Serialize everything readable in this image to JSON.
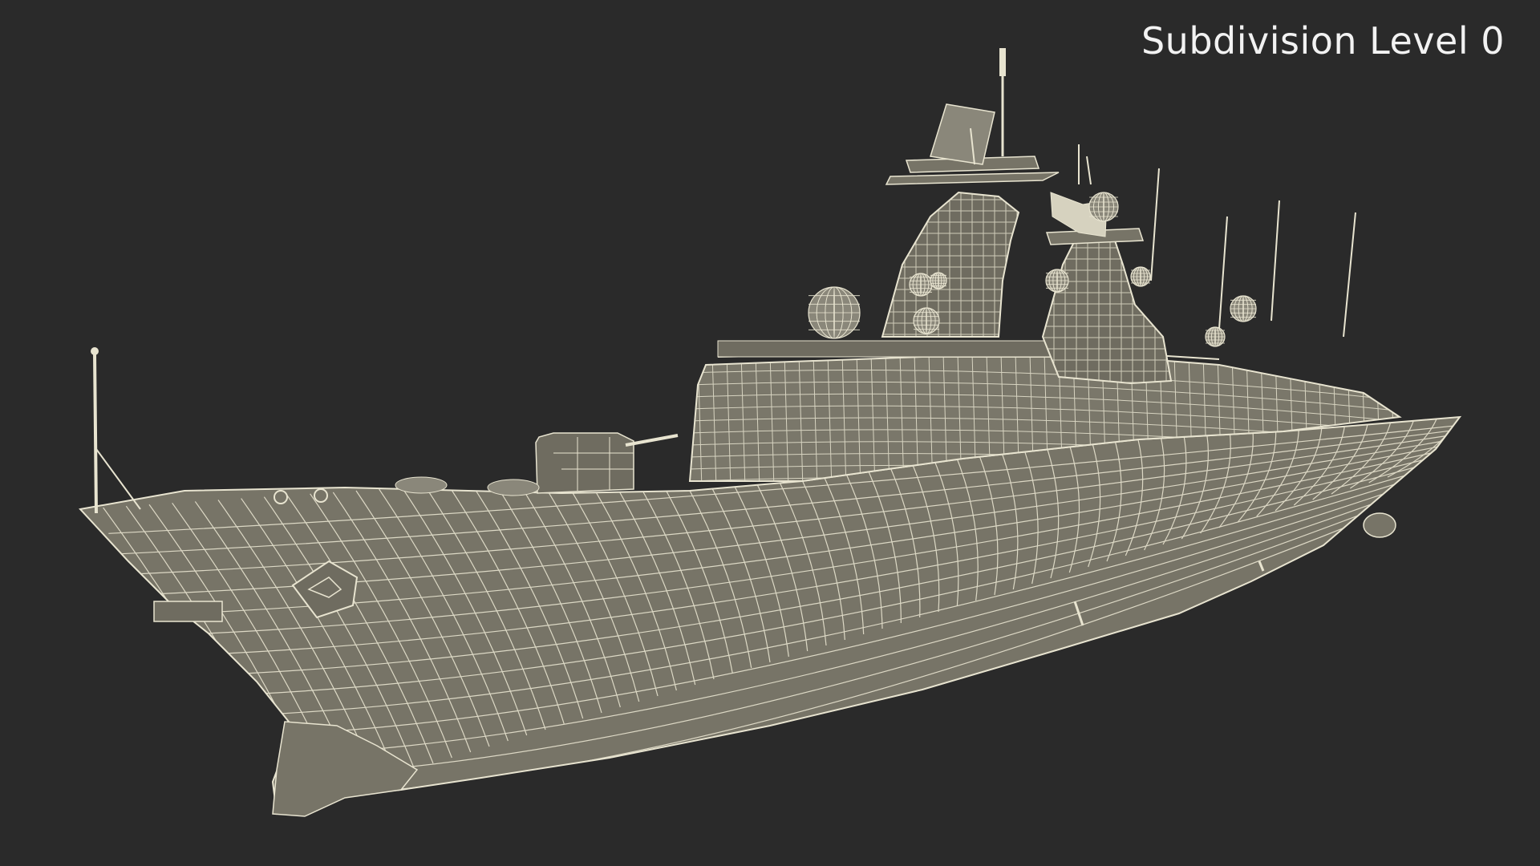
{
  "viewport": {
    "overlay_label": "Subdivision Level 0",
    "background_color": "#2a2a2a",
    "model_fill_color": "#777467",
    "wire_color": "#e8e4d0"
  },
  "model": {
    "name_icon": "warship-wireframe-icon"
  }
}
